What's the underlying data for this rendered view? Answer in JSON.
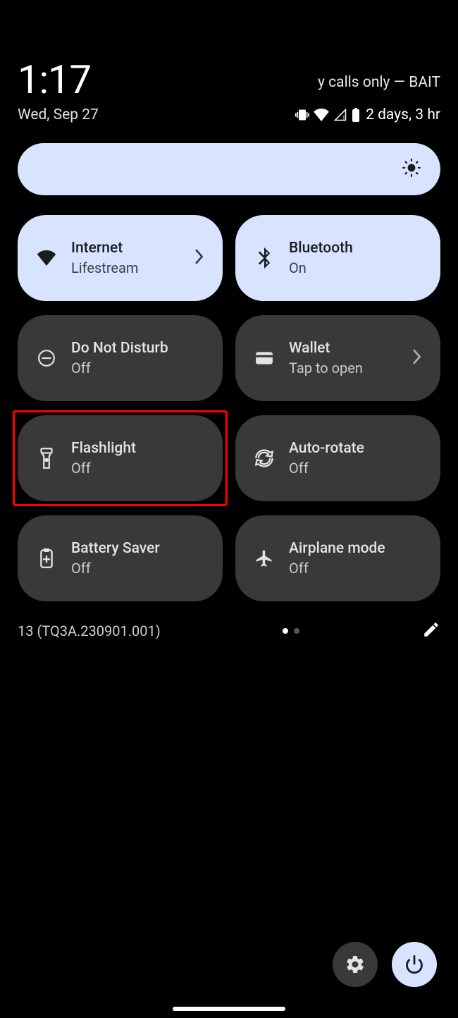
{
  "header": {
    "time": "1:17",
    "carrier": "y calls only — BAIT",
    "date": "Wed, Sep 27",
    "battery_text": "2 days, 3 hr"
  },
  "tiles": {
    "internet": {
      "label": "Internet",
      "sub": "Lifestream"
    },
    "bluetooth": {
      "label": "Bluetooth",
      "sub": "On"
    },
    "dnd": {
      "label": "Do Not Disturb",
      "sub": "Off"
    },
    "wallet": {
      "label": "Wallet",
      "sub": "Tap to open"
    },
    "flashlight": {
      "label": "Flashlight",
      "sub": "Off"
    },
    "autorotate": {
      "label": "Auto-rotate",
      "sub": "Off"
    },
    "battery_saver": {
      "label": "Battery Saver",
      "sub": "Off"
    },
    "airplane": {
      "label": "Airplane mode",
      "sub": "Off"
    }
  },
  "footer": {
    "build": "13 (TQ3A.230901.001)"
  }
}
